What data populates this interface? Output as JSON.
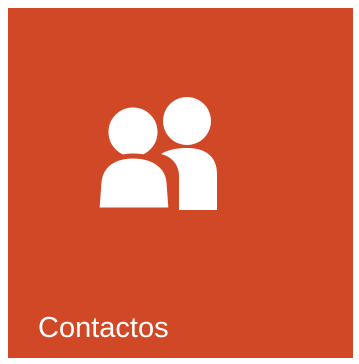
{
  "tile": {
    "label": "Contactos",
    "icon": "people-icon",
    "background_color": "#D14827",
    "foreground_color": "#FFFFFF"
  }
}
